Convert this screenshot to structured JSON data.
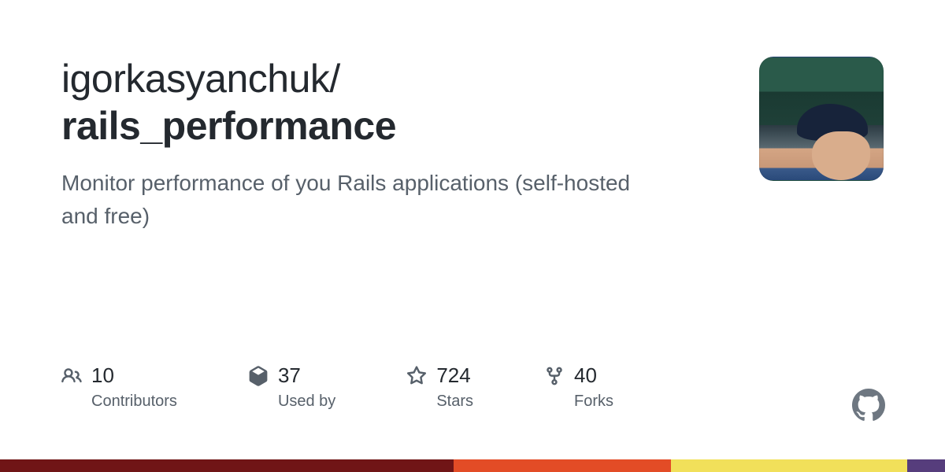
{
  "owner": "igorkasyanchuk/",
  "repo": "rails_performance",
  "description": "Monitor performance of you Rails applications (self-hosted and free)",
  "stats": [
    {
      "icon": "people",
      "value": "10",
      "label": "Contributors"
    },
    {
      "icon": "package-dependents",
      "value": "37",
      "label": "Used by"
    },
    {
      "icon": "star",
      "value": "724",
      "label": "Stars"
    },
    {
      "icon": "repo-forked",
      "value": "40",
      "label": "Forks"
    }
  ],
  "languages": [
    {
      "color": "#701516",
      "percent": 48
    },
    {
      "color": "#e34c26",
      "percent": 23
    },
    {
      "color": "#f1e05a",
      "percent": 25
    },
    {
      "color": "#563d7c",
      "percent": 4
    }
  ]
}
